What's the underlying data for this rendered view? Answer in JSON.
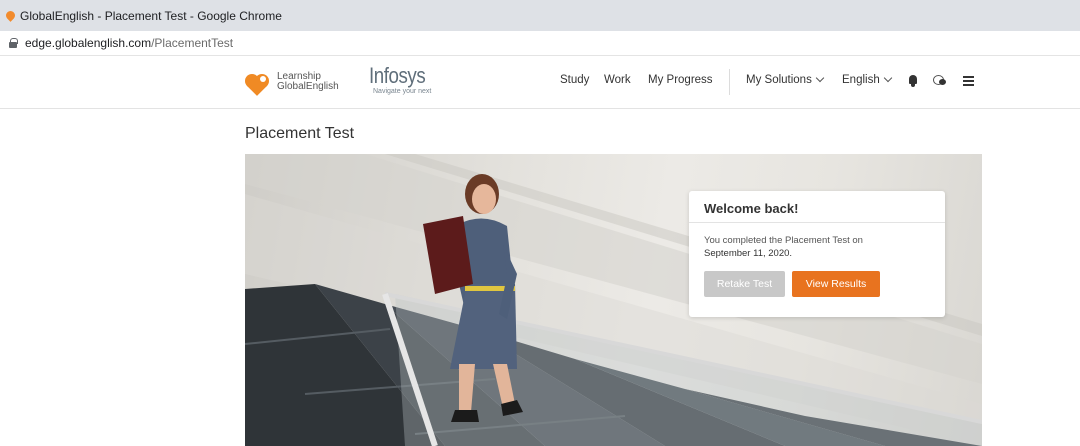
{
  "browser": {
    "window_title": "GlobalEnglish - Placement Test - Google Chrome",
    "url_host": "edge.globalenglish.com",
    "url_path": "/PlacementTest"
  },
  "header": {
    "logo_lge_line1": "Learnship",
    "logo_lge_line2": "GlobalEnglish",
    "logo_infosys": "Infosys",
    "logo_infosys_tag": "Navigate your next",
    "nav": {
      "study": "Study",
      "work": "Work",
      "progress": "My Progress",
      "solutions": "My Solutions",
      "language": "English"
    },
    "icons": [
      "bell-icon",
      "chat-icon",
      "menu-icon"
    ]
  },
  "main": {
    "title": "Placement Test",
    "card": {
      "heading": "Welcome back!",
      "message": "You completed the Placement Test on",
      "date": "September 11, 2020.",
      "retake_label": "Retake Test",
      "view_label": "View Results"
    }
  },
  "colors": {
    "accent_orange": "#e8731f",
    "disabled_gray": "#c8c8c8",
    "logo_orange": "#f08a24"
  }
}
